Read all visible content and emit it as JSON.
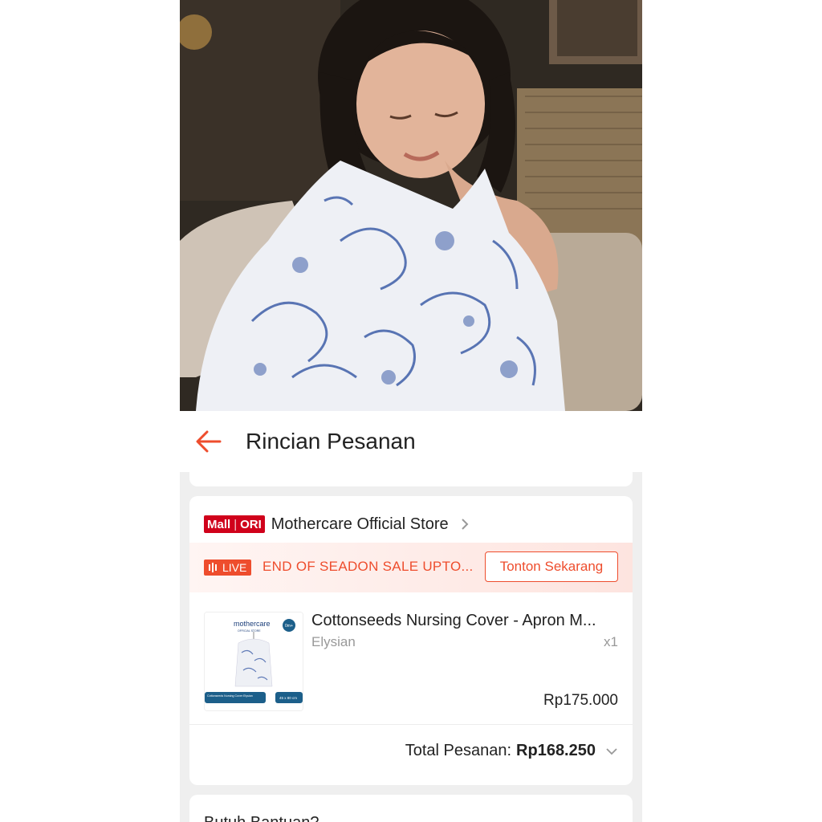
{
  "header": {
    "title": "Rincian Pesanan"
  },
  "store": {
    "badge_mall": "Mall",
    "badge_ori": "ORI",
    "name": "Mothercare Official Store"
  },
  "live": {
    "badge": "LIVE",
    "text": "END OF SEADON SALE UPTO...",
    "button": "Tonton Sekarang"
  },
  "product": {
    "name": "Cottonseeds Nursing Cover - Apron M...",
    "variant": "Elysian",
    "qty": "x1",
    "price": "Rp175.000",
    "thumb_brand": "mothercare",
    "thumb_sub": "OFFICIAL STORE",
    "thumb_badge": "0m+",
    "thumb_caption": "Cottonseeds Nursing Cover Elysian",
    "thumb_size": "45 x 80 cm"
  },
  "order": {
    "total_label": "Total Pesanan:",
    "total_amount": "Rp168.250"
  },
  "help": {
    "title": "Butuh Bantuan?"
  },
  "colors": {
    "accent": "#ee4d2d",
    "mall": "#d0011b"
  }
}
